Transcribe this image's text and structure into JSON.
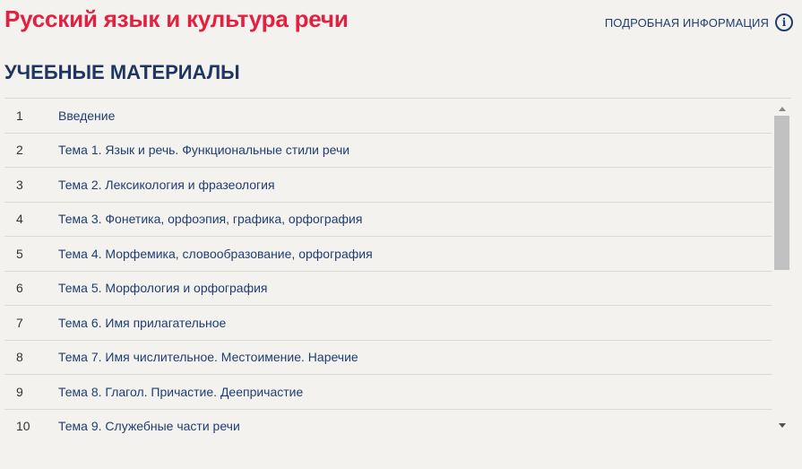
{
  "header": {
    "course_title": "Русский язык и культура речи",
    "info_label": "ПОДРОБНАЯ ИНФОРМАЦИЯ",
    "info_icon": "info-circle-icon"
  },
  "section": {
    "title": "УЧЕБНЫЕ МАТЕРИАЛЫ"
  },
  "materials": [
    {
      "num": "1",
      "title": "Введение"
    },
    {
      "num": "2",
      "title": "Тема 1. Язык и речь. Функциональные стили речи"
    },
    {
      "num": "3",
      "title": "Тема 2. Лексикология и фразеология"
    },
    {
      "num": "4",
      "title": "Тема 3. Фонетика, орфоэпия, графика, орфография"
    },
    {
      "num": "5",
      "title": "Тема 4. Морфемика, словообразование, орфография"
    },
    {
      "num": "6",
      "title": "Тема 5. Морфология и орфография"
    },
    {
      "num": "7",
      "title": "Тема 6. Имя прилагательное"
    },
    {
      "num": "8",
      "title": "Тема 7. Имя числительное. Местоимение. Наречие"
    },
    {
      "num": "9",
      "title": "Тема 8. Глагол. Причастие. Деепричастие"
    },
    {
      "num": "10",
      "title": "Тема 9. Служебные части речи"
    }
  ],
  "colors": {
    "course_title": "#e41f3f",
    "link": "#1f3f70",
    "background": "#f3f2ef"
  }
}
